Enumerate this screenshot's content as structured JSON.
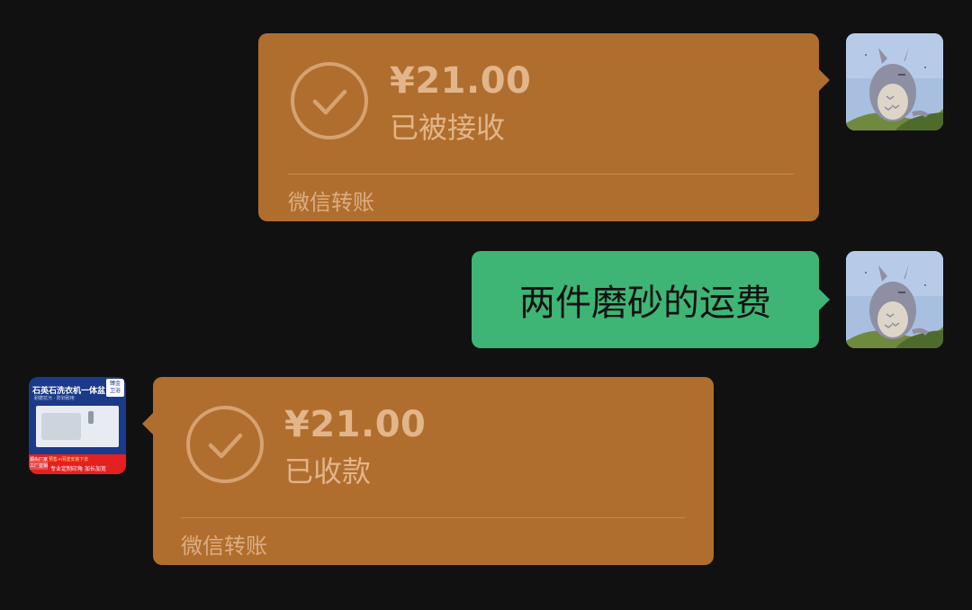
{
  "colors": {
    "background": "#111111",
    "transfer_bubble": "#b06e2e",
    "text_bubble": "#3eb575"
  },
  "messages": [
    {
      "type": "transfer",
      "direction": "outgoing",
      "amount": "¥21.00",
      "status": "已被接收",
      "footer": "微信转账",
      "avatar_icon": "totoro-avatar-icon"
    },
    {
      "type": "text",
      "direction": "outgoing",
      "text": "两件磨砂的运费",
      "avatar_icon": "totoro-avatar-icon"
    },
    {
      "type": "transfer",
      "direction": "incoming",
      "amount": "¥21.00",
      "status": "已收款",
      "footer": "微信转账",
      "avatar_icon": "shop-logo-avatar-icon"
    }
  ],
  "shop_avatar": {
    "title": "石英石洗衣机一体盆",
    "badge_line1": "臻金",
    "badge_line2": "卫浴",
    "subtitle": "耐磨抗污 · 防划耐用",
    "red_top": "预售+闲送安装下去",
    "red_bottom": "专业定制印角 加长加宽",
    "red_left_line1": "源头厂家",
    "red_left_line2": "工厂直销"
  }
}
